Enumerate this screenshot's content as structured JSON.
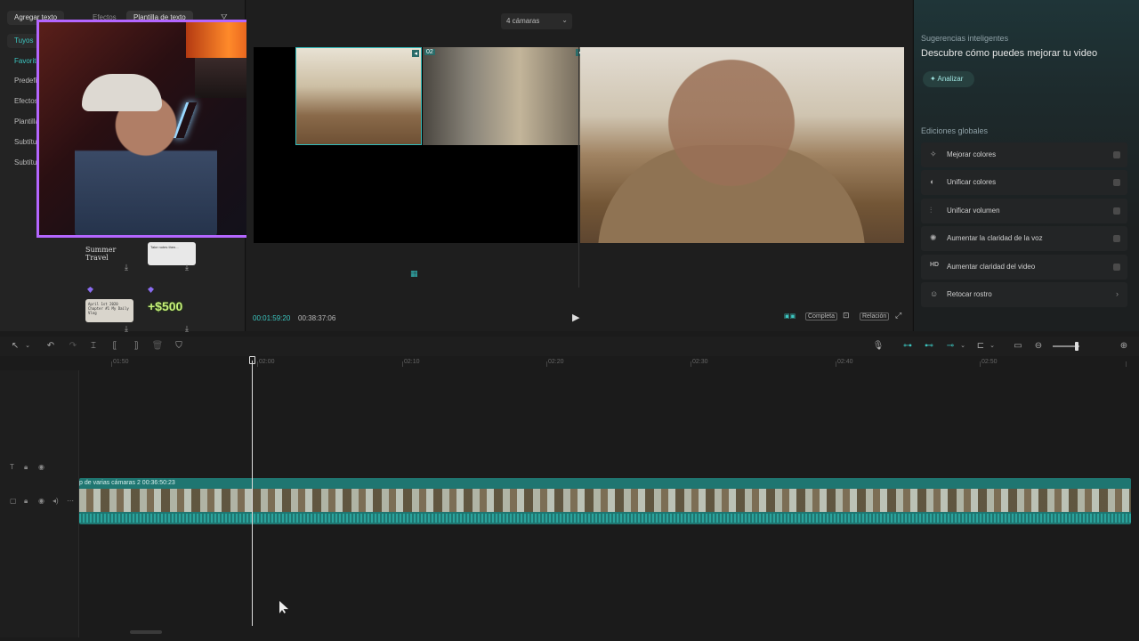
{
  "left_panel": {
    "tabs": {
      "text": "Agregar texto",
      "effects": "Efectos",
      "template": "Plantilla de texto"
    },
    "nav": [
      "Tuyos",
      "Favoritos",
      "Predefinidos",
      "Efectos",
      "Plantillas",
      "Subtítulos",
      "Subtítulos"
    ],
    "templates": {
      "summer": "Summer Travel",
      "note": "Take notes then...",
      "april": "April 1st 2020 Chapter #1 My Daily Vlog",
      "price": "+$500"
    }
  },
  "preview": {
    "cameras_select": "4 cámaras",
    "cam2_badge": "02",
    "time_current": "00:01:59:20",
    "time_total": "00:38:37:06",
    "quality": "Completa",
    "ratio": "Relación"
  },
  "right_panel": {
    "smart_title": "Sugerencias inteligentes",
    "smart_subtitle": "Descubre cómo puedes mejorar tu video",
    "analyze": "Analizar",
    "global_title": "Ediciones globales",
    "items": [
      {
        "label": "Mejorar colores",
        "icon": "wand-icon"
      },
      {
        "label": "Unificar colores",
        "icon": "palette-icon"
      },
      {
        "label": "Unificar volumen",
        "icon": "sliders-icon"
      },
      {
        "label": "Aumentar la claridad de la voz",
        "icon": "sparkle-icon"
      },
      {
        "label": "Aumentar claridad del video",
        "icon": "hd-icon"
      },
      {
        "label": "Retocar rostro",
        "icon": "face-icon"
      }
    ]
  },
  "timeline": {
    "ticks": [
      "01:50",
      "02:00",
      "02:10",
      "02:20",
      "02:30",
      "02:40",
      "02:50"
    ],
    "clip_label": "p de varias cámaras 2   00:36:50:23"
  },
  "colors": {
    "accent": "#3cc6c0",
    "webcam_border": "#b466ff",
    "clip": "#1f7671"
  }
}
